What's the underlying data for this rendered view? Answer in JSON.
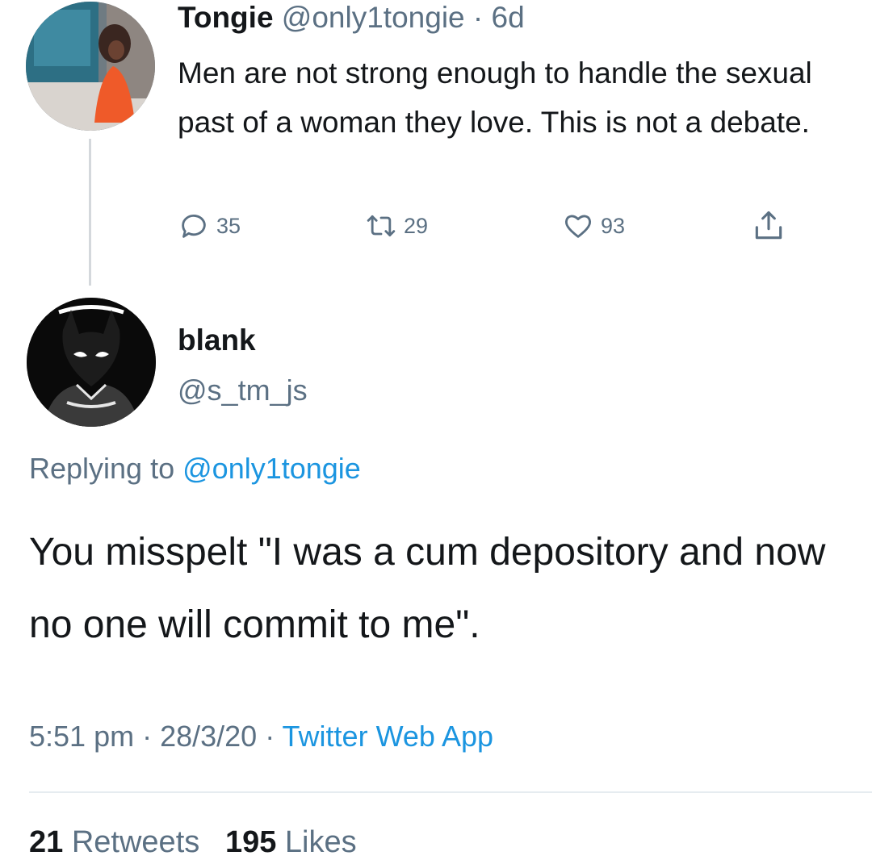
{
  "original_tweet": {
    "author_name": "Tongie",
    "author_handle": "@only1tongie",
    "separator": " · ",
    "time_ago": "6d",
    "text": "Men are not strong enough to handle the sexual past of a woman they love. This is not a debate.",
    "actions": {
      "reply_icon": "speech-bubble-icon",
      "reply_count": "35",
      "retweet_icon": "retweet-icon",
      "retweet_count": "29",
      "like_icon": "heart-icon",
      "like_count": "93",
      "share_icon": "share-icon"
    }
  },
  "reply_tweet": {
    "author_name": "blank",
    "author_handle": "@s_tm_js",
    "replying_prefix": "Replying to",
    "replying_handle": "@only1tongie",
    "text": "You misspelt \"I was a cum depository and now no one will commit to me\".",
    "time": "5:51 pm",
    "date": "28/3/20",
    "source": "Twitter Web App",
    "dot": " · ",
    "retweets_count": "21",
    "retweets_label": "Retweets",
    "likes_count": "195",
    "likes_label": "Likes"
  },
  "colors": {
    "text_primary": "#14171a",
    "text_secondary": "#5b7083",
    "link": "#1b95e0",
    "divider": "#e6ecf0"
  }
}
